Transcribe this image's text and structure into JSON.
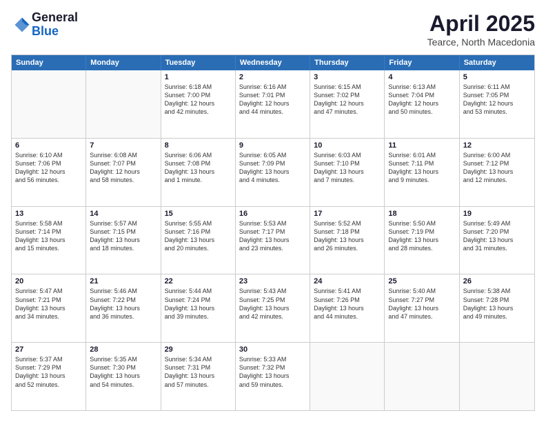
{
  "header": {
    "logo": {
      "general": "General",
      "blue": "Blue"
    },
    "title": "April 2025",
    "location": "Tearce, North Macedonia"
  },
  "weekdays": [
    "Sunday",
    "Monday",
    "Tuesday",
    "Wednesday",
    "Thursday",
    "Friday",
    "Saturday"
  ],
  "weeks": [
    [
      {
        "day": "",
        "info": ""
      },
      {
        "day": "",
        "info": ""
      },
      {
        "day": "1",
        "info": "Sunrise: 6:18 AM\nSunset: 7:00 PM\nDaylight: 12 hours\nand 42 minutes."
      },
      {
        "day": "2",
        "info": "Sunrise: 6:16 AM\nSunset: 7:01 PM\nDaylight: 12 hours\nand 44 minutes."
      },
      {
        "day": "3",
        "info": "Sunrise: 6:15 AM\nSunset: 7:02 PM\nDaylight: 12 hours\nand 47 minutes."
      },
      {
        "day": "4",
        "info": "Sunrise: 6:13 AM\nSunset: 7:04 PM\nDaylight: 12 hours\nand 50 minutes."
      },
      {
        "day": "5",
        "info": "Sunrise: 6:11 AM\nSunset: 7:05 PM\nDaylight: 12 hours\nand 53 minutes."
      }
    ],
    [
      {
        "day": "6",
        "info": "Sunrise: 6:10 AM\nSunset: 7:06 PM\nDaylight: 12 hours\nand 56 minutes."
      },
      {
        "day": "7",
        "info": "Sunrise: 6:08 AM\nSunset: 7:07 PM\nDaylight: 12 hours\nand 58 minutes."
      },
      {
        "day": "8",
        "info": "Sunrise: 6:06 AM\nSunset: 7:08 PM\nDaylight: 13 hours\nand 1 minute."
      },
      {
        "day": "9",
        "info": "Sunrise: 6:05 AM\nSunset: 7:09 PM\nDaylight: 13 hours\nand 4 minutes."
      },
      {
        "day": "10",
        "info": "Sunrise: 6:03 AM\nSunset: 7:10 PM\nDaylight: 13 hours\nand 7 minutes."
      },
      {
        "day": "11",
        "info": "Sunrise: 6:01 AM\nSunset: 7:11 PM\nDaylight: 13 hours\nand 9 minutes."
      },
      {
        "day": "12",
        "info": "Sunrise: 6:00 AM\nSunset: 7:12 PM\nDaylight: 13 hours\nand 12 minutes."
      }
    ],
    [
      {
        "day": "13",
        "info": "Sunrise: 5:58 AM\nSunset: 7:14 PM\nDaylight: 13 hours\nand 15 minutes."
      },
      {
        "day": "14",
        "info": "Sunrise: 5:57 AM\nSunset: 7:15 PM\nDaylight: 13 hours\nand 18 minutes."
      },
      {
        "day": "15",
        "info": "Sunrise: 5:55 AM\nSunset: 7:16 PM\nDaylight: 13 hours\nand 20 minutes."
      },
      {
        "day": "16",
        "info": "Sunrise: 5:53 AM\nSunset: 7:17 PM\nDaylight: 13 hours\nand 23 minutes."
      },
      {
        "day": "17",
        "info": "Sunrise: 5:52 AM\nSunset: 7:18 PM\nDaylight: 13 hours\nand 26 minutes."
      },
      {
        "day": "18",
        "info": "Sunrise: 5:50 AM\nSunset: 7:19 PM\nDaylight: 13 hours\nand 28 minutes."
      },
      {
        "day": "19",
        "info": "Sunrise: 5:49 AM\nSunset: 7:20 PM\nDaylight: 13 hours\nand 31 minutes."
      }
    ],
    [
      {
        "day": "20",
        "info": "Sunrise: 5:47 AM\nSunset: 7:21 PM\nDaylight: 13 hours\nand 34 minutes."
      },
      {
        "day": "21",
        "info": "Sunrise: 5:46 AM\nSunset: 7:22 PM\nDaylight: 13 hours\nand 36 minutes."
      },
      {
        "day": "22",
        "info": "Sunrise: 5:44 AM\nSunset: 7:24 PM\nDaylight: 13 hours\nand 39 minutes."
      },
      {
        "day": "23",
        "info": "Sunrise: 5:43 AM\nSunset: 7:25 PM\nDaylight: 13 hours\nand 42 minutes."
      },
      {
        "day": "24",
        "info": "Sunrise: 5:41 AM\nSunset: 7:26 PM\nDaylight: 13 hours\nand 44 minutes."
      },
      {
        "day": "25",
        "info": "Sunrise: 5:40 AM\nSunset: 7:27 PM\nDaylight: 13 hours\nand 47 minutes."
      },
      {
        "day": "26",
        "info": "Sunrise: 5:38 AM\nSunset: 7:28 PM\nDaylight: 13 hours\nand 49 minutes."
      }
    ],
    [
      {
        "day": "27",
        "info": "Sunrise: 5:37 AM\nSunset: 7:29 PM\nDaylight: 13 hours\nand 52 minutes."
      },
      {
        "day": "28",
        "info": "Sunrise: 5:35 AM\nSunset: 7:30 PM\nDaylight: 13 hours\nand 54 minutes."
      },
      {
        "day": "29",
        "info": "Sunrise: 5:34 AM\nSunset: 7:31 PM\nDaylight: 13 hours\nand 57 minutes."
      },
      {
        "day": "30",
        "info": "Sunrise: 5:33 AM\nSunset: 7:32 PM\nDaylight: 13 hours\nand 59 minutes."
      },
      {
        "day": "",
        "info": ""
      },
      {
        "day": "",
        "info": ""
      },
      {
        "day": "",
        "info": ""
      }
    ]
  ]
}
